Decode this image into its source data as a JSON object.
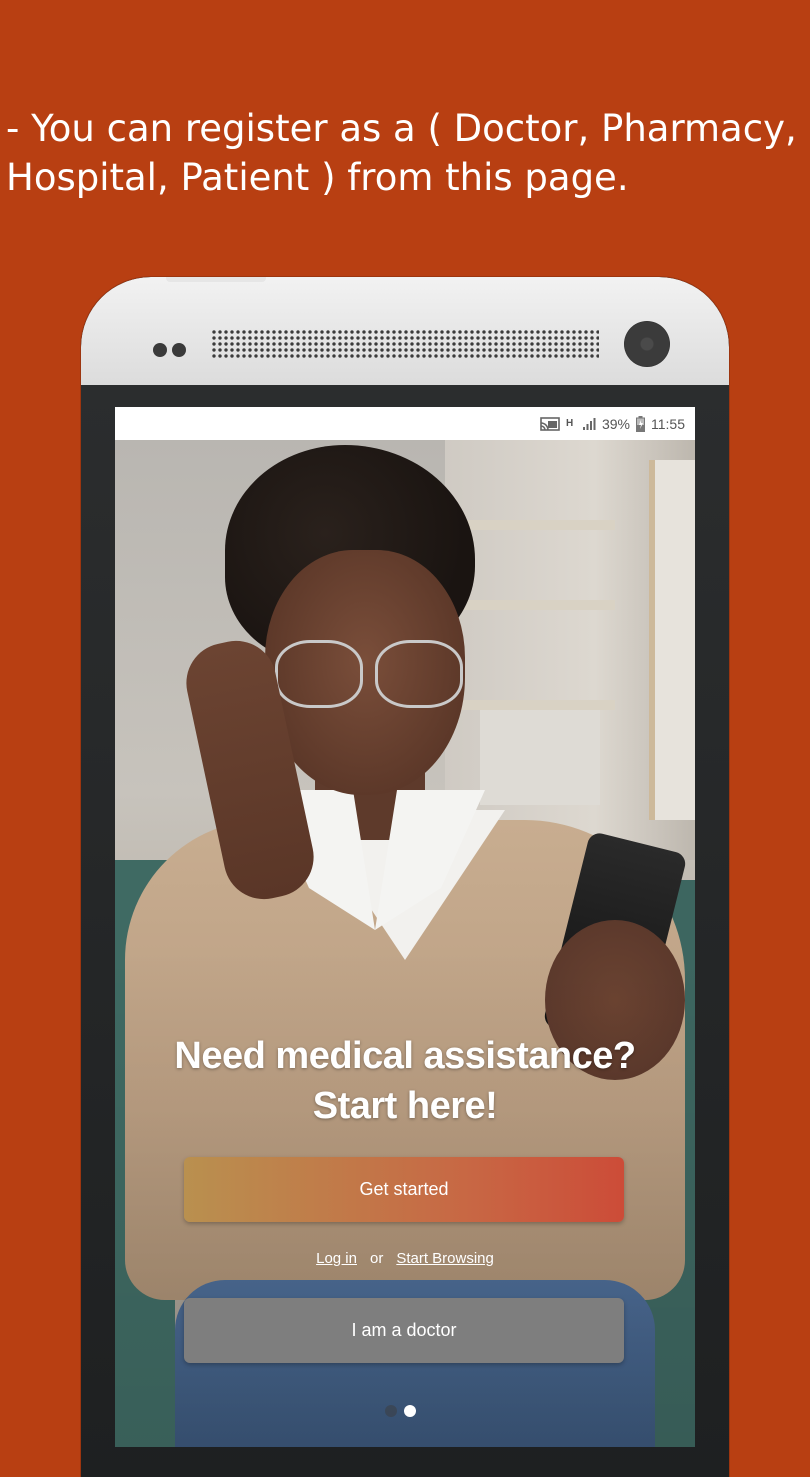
{
  "caption": {
    "line1": "-  You can register as a ( Doctor, Pharmacy,",
    "line2": "Hospital, Patient ) from this page."
  },
  "status_bar": {
    "network_type": "H",
    "battery": "39%",
    "time": "11:55",
    "icons": [
      "cast-icon",
      "signal-icon",
      "battery-charging-icon"
    ]
  },
  "hero": {
    "headline_line1": "Need medical assistance?",
    "headline_line2": "Start here!"
  },
  "actions": {
    "get_started": "Get started",
    "login": "Log in",
    "or": "or",
    "start_browsing": "Start Browsing",
    "doctor": "I am a doctor"
  },
  "pager": {
    "count": 2,
    "active_index": 1
  },
  "colors": {
    "background": "#b83f12",
    "get_started_gradient": [
      "#b9904f",
      "#cc4c38"
    ],
    "doctor_button": "#7e7e7e"
  }
}
